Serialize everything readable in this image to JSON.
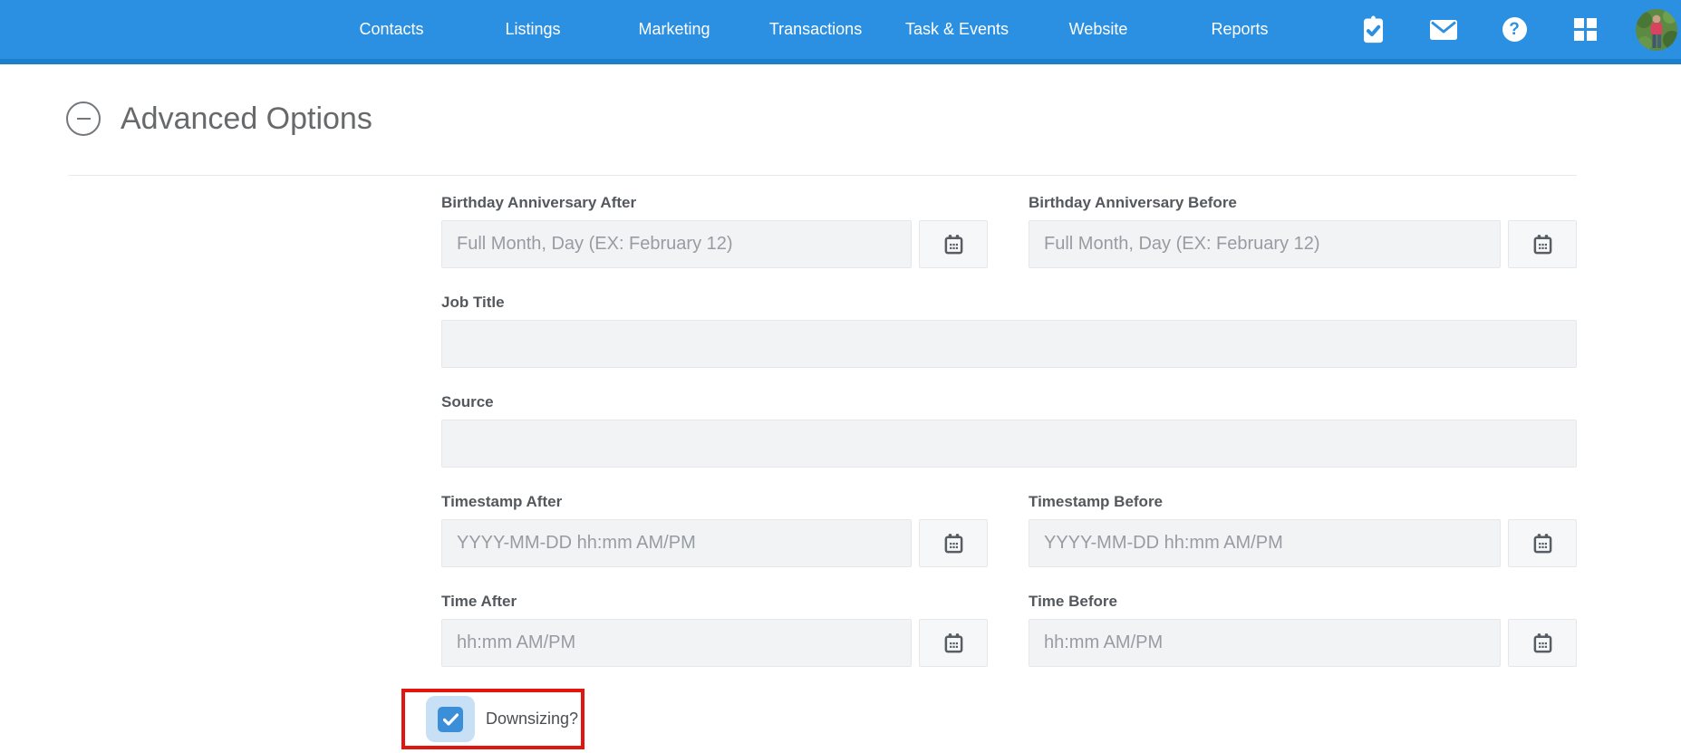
{
  "nav": {
    "items": [
      {
        "label": "Contacts"
      },
      {
        "label": "Listings"
      },
      {
        "label": "Marketing"
      },
      {
        "label": "Transactions"
      },
      {
        "label": "Task & Events"
      },
      {
        "label": "Website"
      },
      {
        "label": "Reports"
      }
    ],
    "icons": [
      {
        "name": "tasks-clipboard-icon"
      },
      {
        "name": "mail-icon"
      },
      {
        "name": "help-icon"
      },
      {
        "name": "apps-grid-icon"
      },
      {
        "name": "user-avatar"
      }
    ],
    "help_glyph": "?"
  },
  "section": {
    "title": "Advanced Options"
  },
  "form": {
    "birthday_after": {
      "label": "Birthday Anniversary After",
      "placeholder": "Full Month, Day (EX: February 12)",
      "value": ""
    },
    "birthday_before": {
      "label": "Birthday Anniversary Before",
      "placeholder": "Full Month, Day (EX: February 12)",
      "value": ""
    },
    "job_title": {
      "label": "Job Title",
      "value": ""
    },
    "source": {
      "label": "Source",
      "value": ""
    },
    "timestamp_after": {
      "label": "Timestamp After",
      "placeholder": "YYYY-MM-DD hh:mm AM/PM",
      "value": ""
    },
    "timestamp_before": {
      "label": "Timestamp Before",
      "placeholder": "YYYY-MM-DD hh:mm AM/PM",
      "value": ""
    },
    "time_after": {
      "label": "Time After",
      "placeholder": "hh:mm AM/PM",
      "value": ""
    },
    "time_before": {
      "label": "Time Before",
      "placeholder": "hh:mm AM/PM",
      "value": ""
    },
    "downsizing": {
      "label": "Downsizing?",
      "checked": true
    }
  },
  "annotation": {
    "type": "red-highlight-box",
    "target": "downsizing-checkbox"
  },
  "colors": {
    "navbar": "#2b90e1",
    "navbar_border": "#1d7ecb",
    "input_bg": "#f2f3f5",
    "checkbox_blue": "#3b8fd8",
    "checkbox_halo": "#c7e0f5",
    "annotation_red": "#e0160f"
  }
}
